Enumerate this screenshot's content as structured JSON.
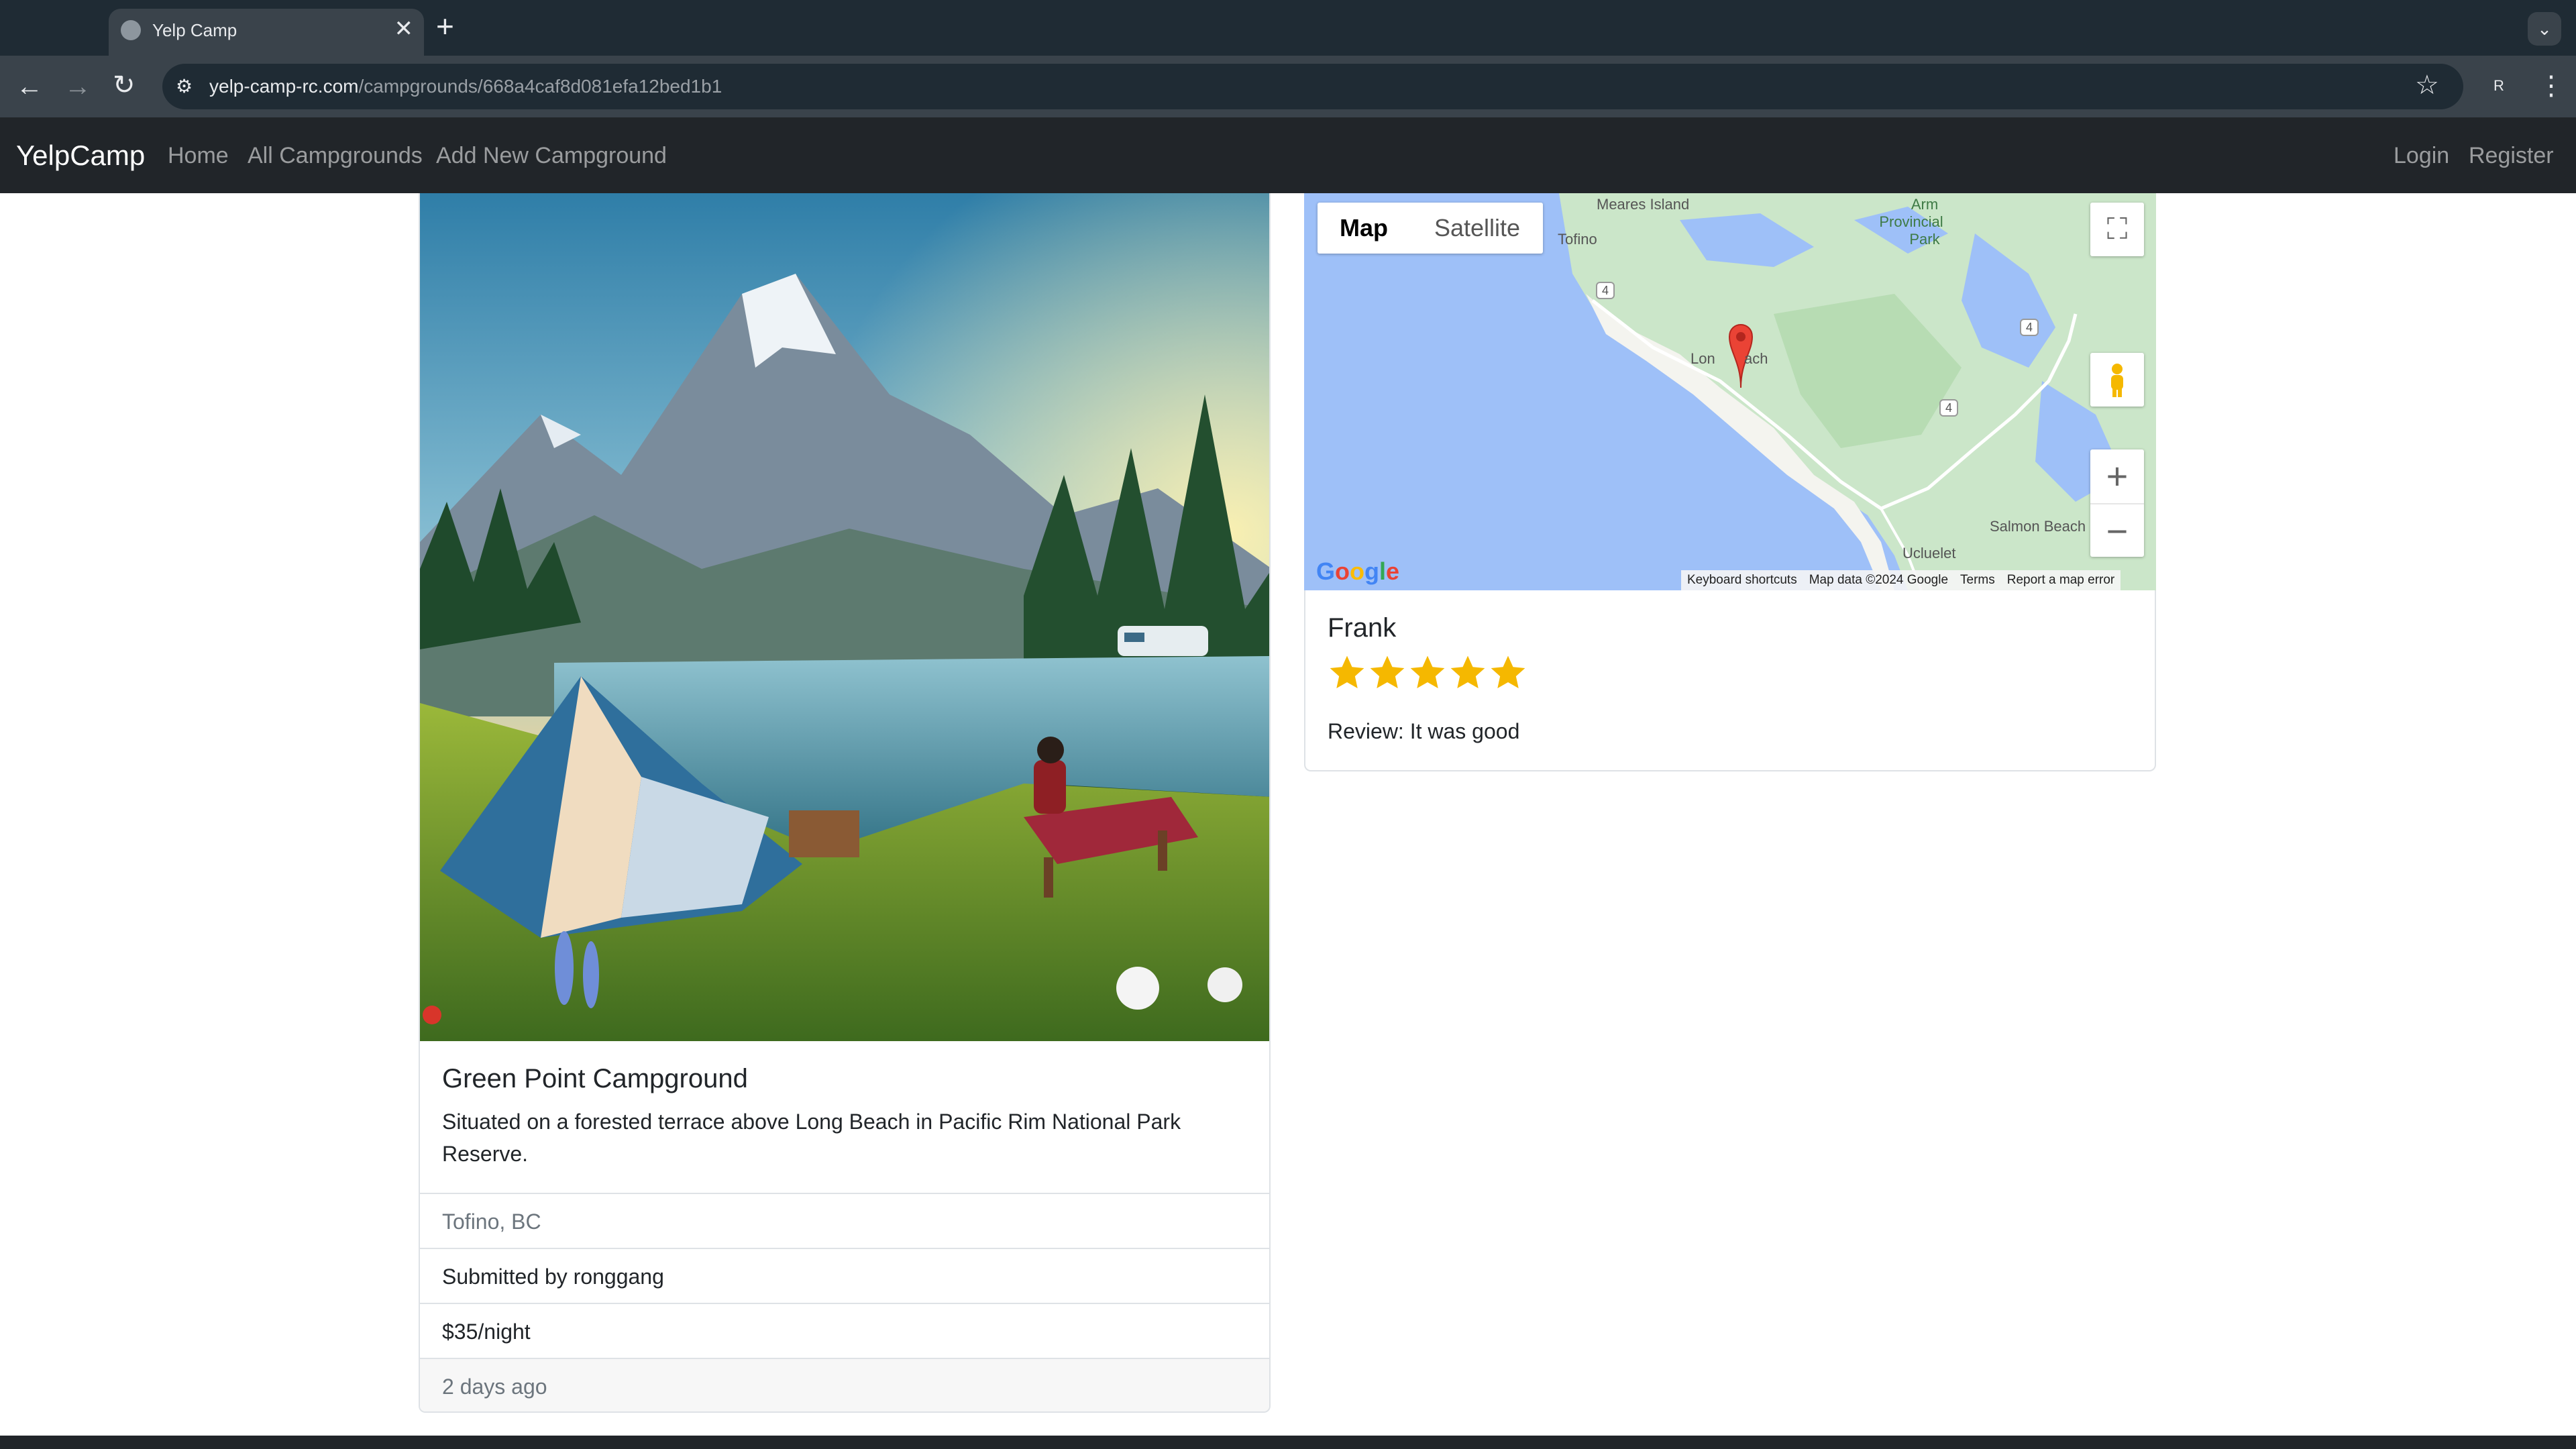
{
  "browser": {
    "tab_title": "Yelp Camp",
    "new_tab_glyph": "+",
    "close_glyph": "✕",
    "url_domain": "yelp-camp-rc.com",
    "url_path": "/campgrounds/668a4caf8d081efa12bed1b1",
    "profile_initial": "R"
  },
  "navbar": {
    "brand": "YelpCamp",
    "links": [
      "Home",
      "All Campgrounds",
      "Add New Campground"
    ],
    "login": "Login",
    "register": "Register"
  },
  "campground": {
    "title": "Green Point Campground",
    "description": "Situated on a forested terrace above Long Beach in Pacific Rim National Park Reserve.",
    "location": "Tofino, BC",
    "submitted_by": "Submitted by ronggang",
    "price": "$35/night",
    "posted": "2 days ago"
  },
  "map": {
    "type_map": "Map",
    "type_satellite": "Satellite",
    "labels": {
      "meares": "Meares Island",
      "tofino": "Tofino",
      "arm_park_1": "Arm",
      "arm_park_2": "Provincial",
      "arm_park_3": "Park",
      "long_beach_a": "Lon",
      "long_beach_b": "ach",
      "ucluelet": "Ucluelet",
      "salmon_beach": "Salmon Beach",
      "route": "4"
    },
    "logo": "Google",
    "footer": [
      "Keyboard shortcuts",
      "Map data ©2024 Google",
      "Terms",
      "Report a map error"
    ],
    "zoom_in": "+",
    "zoom_out": "−",
    "fullscreen": "⛶"
  },
  "review": {
    "author": "Frank",
    "rating": 5,
    "rating_max": 5,
    "text": "Review: It was good"
  },
  "colors": {
    "navbar_bg": "#212529",
    "star": "#f5b800",
    "marker": "#ea4335",
    "water": "#9ec0f8",
    "land": "#cbe6c9"
  }
}
